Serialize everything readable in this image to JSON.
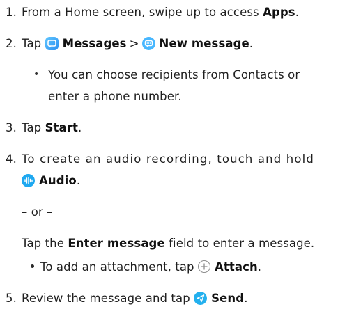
{
  "steps": [
    {
      "num": "1.",
      "text_before": "From a Home screen, swipe up to access ",
      "bold": "Apps",
      "text_after": "."
    },
    {
      "num": "2.",
      "tap": "Tap",
      "bold1": "Messages",
      "sep": ">",
      "bold2": "New message",
      "end": "."
    },
    {
      "bullet_line1": "You can choose recipients from Contacts or",
      "bullet_line2": "enter a phone number."
    },
    {
      "num": "3.",
      "tap": "Tap ",
      "bold": "Start",
      "end": "."
    },
    {
      "num": "4.",
      "line1": "To create an audio recording, touch and hold",
      "bold": "Audio",
      "end": "."
    },
    {
      "or_text": "– or –"
    },
    {
      "tap": "Tap the ",
      "bold": "Enter message",
      "rest": " field to enter a message."
    },
    {
      "bullet_text": "To add an attachment, tap",
      "bold": "Attach",
      "end": "."
    },
    {
      "num": "5.",
      "text": "Review the message and tap",
      "bold": "Send",
      "end": "."
    }
  ],
  "icons": {
    "messages_app": "messages-app-icon",
    "new_message": "new-message-icon",
    "audio": "audio-icon",
    "attach": "attach-icon",
    "send": "send-icon"
  },
  "colors": {
    "icon_blue": "#2d8ff0",
    "text": "#1f1f1f"
  }
}
